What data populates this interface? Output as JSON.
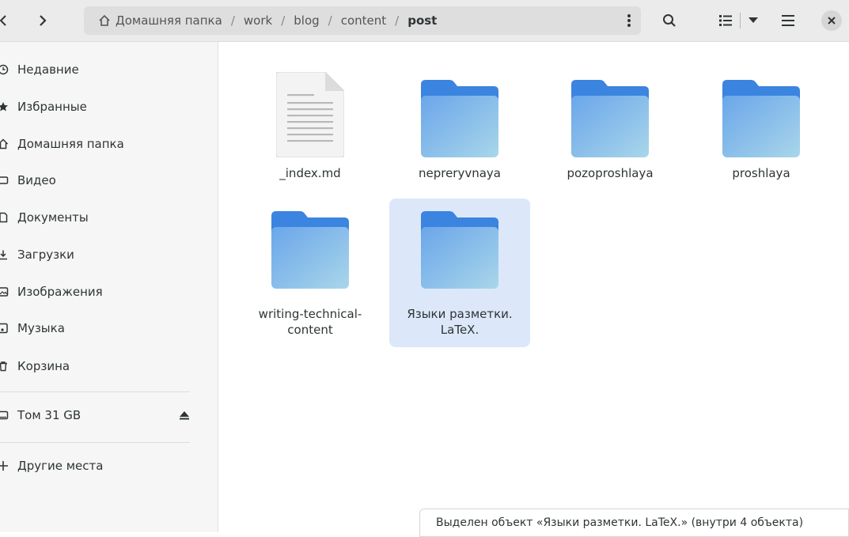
{
  "header": {
    "path": [
      {
        "label": "Домашняя папка"
      },
      {
        "label": "work"
      },
      {
        "label": "blog"
      },
      {
        "label": "content"
      },
      {
        "label": "post"
      }
    ],
    "separator": "/"
  },
  "sidebar": {
    "items": [
      {
        "label": "Недавние",
        "icon": "clock-icon"
      },
      {
        "label": "Избранные",
        "icon": "star-icon"
      },
      {
        "label": "Домашняя папка",
        "icon": "home-icon"
      },
      {
        "label": "Видео",
        "icon": "video-icon"
      },
      {
        "label": "Документы",
        "icon": "document-icon"
      },
      {
        "label": "Загрузки",
        "icon": "download-icon"
      },
      {
        "label": "Изображения",
        "icon": "image-icon"
      },
      {
        "label": "Музыка",
        "icon": "music-icon"
      },
      {
        "label": "Корзина",
        "icon": "trash-icon"
      }
    ],
    "volume": {
      "label": "Том 31 GB",
      "icon": "drive-icon"
    },
    "other": {
      "label": "Другие места",
      "icon": "plus-icon"
    }
  },
  "files": [
    {
      "name": "_index.md",
      "type": "document"
    },
    {
      "name": "nepreryvnaya",
      "type": "folder"
    },
    {
      "name": "pozoproshlaya",
      "type": "folder"
    },
    {
      "name": "proshlaya",
      "type": "folder"
    },
    {
      "name": "writing-technical-content",
      "type": "folder"
    },
    {
      "name": "Языки разметки. LaTeX.",
      "type": "folder",
      "selected": true
    }
  ],
  "status": "Выделен объект «Языки разметки. LaTeX.» (внутри 4 объекта)",
  "colors": {
    "selection": "#dce8f9",
    "folder_top": "#3b84e0",
    "folder_body": "#8fc0ec"
  }
}
